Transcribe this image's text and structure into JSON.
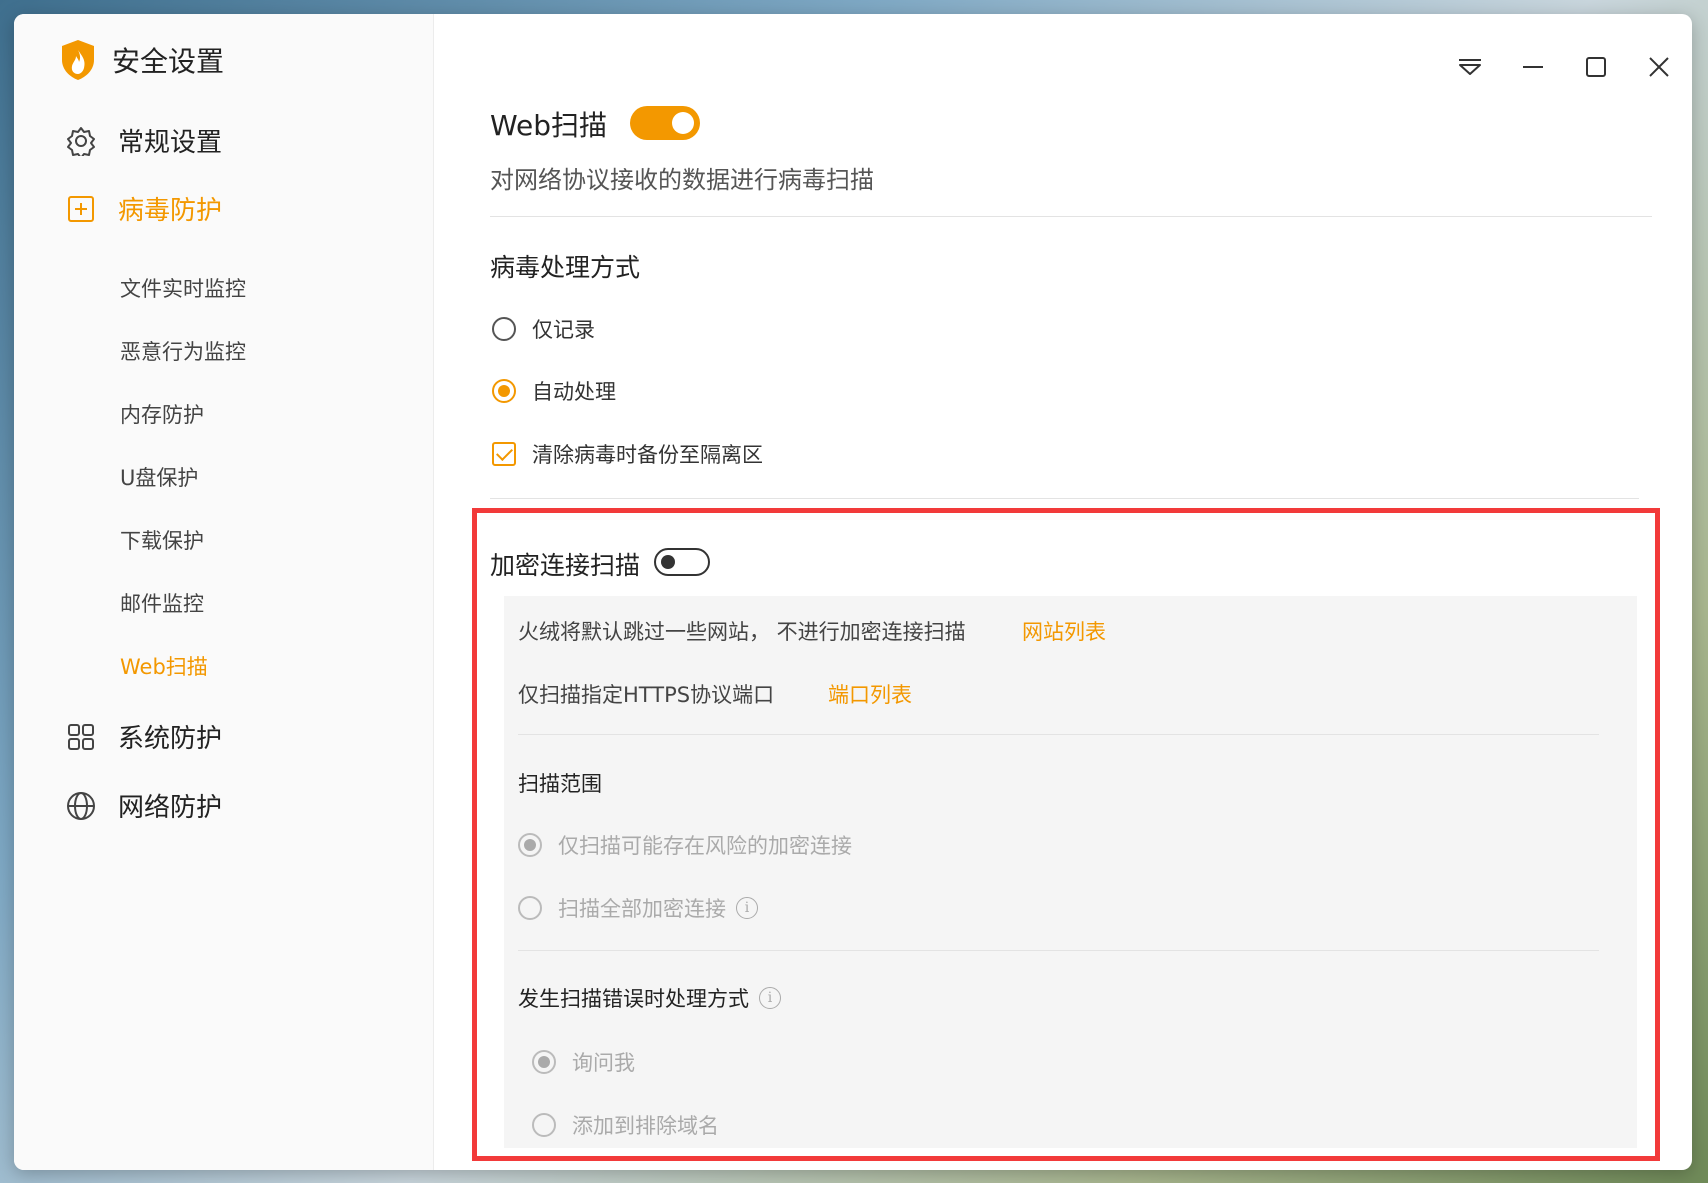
{
  "app": {
    "title": "安全设置"
  },
  "sidebar": {
    "items": [
      {
        "label": "常规设置"
      },
      {
        "label": "病毒防护"
      },
      {
        "label": "系统防护"
      },
      {
        "label": "网络防护"
      }
    ],
    "subitems": [
      {
        "label": "文件实时监控"
      },
      {
        "label": "恶意行为监控"
      },
      {
        "label": "内存防护"
      },
      {
        "label": "U盘保护"
      },
      {
        "label": "下载保护"
      },
      {
        "label": "邮件监控"
      },
      {
        "label": "Web扫描"
      }
    ]
  },
  "main": {
    "title": "Web扫描",
    "web_scan_enabled": true,
    "description": "对网络协议接收的数据进行病毒扫描",
    "virus_handling": {
      "heading": "病毒处理方式",
      "options": [
        {
          "label": "仅记录",
          "checked": false
        },
        {
          "label": "自动处理",
          "checked": true
        }
      ],
      "backup": {
        "label": "清除病毒时备份至隔离区",
        "checked": true
      }
    },
    "encrypted": {
      "title": "加密连接扫描",
      "enabled": false,
      "skip_text": "火绒将默认跳过一些网站，  不进行加密连接扫描",
      "site_list_link": "网站列表",
      "port_text": "仅扫描指定HTTPS协议端口",
      "port_list_link": "端口列表",
      "scope_heading": "扫描范围",
      "scope_options": [
        {
          "label": "仅扫描可能存在风险的加密连接",
          "checked": true
        },
        {
          "label": "扫描全部加密连接",
          "checked": false
        }
      ],
      "error_heading": "发生扫描错误时处理方式",
      "error_options": [
        {
          "label": "询问我",
          "checked": true
        },
        {
          "label": "添加到排除域名",
          "checked": false
        }
      ]
    }
  },
  "colors": {
    "accent": "#f39800",
    "highlight": "#f23a3a"
  }
}
